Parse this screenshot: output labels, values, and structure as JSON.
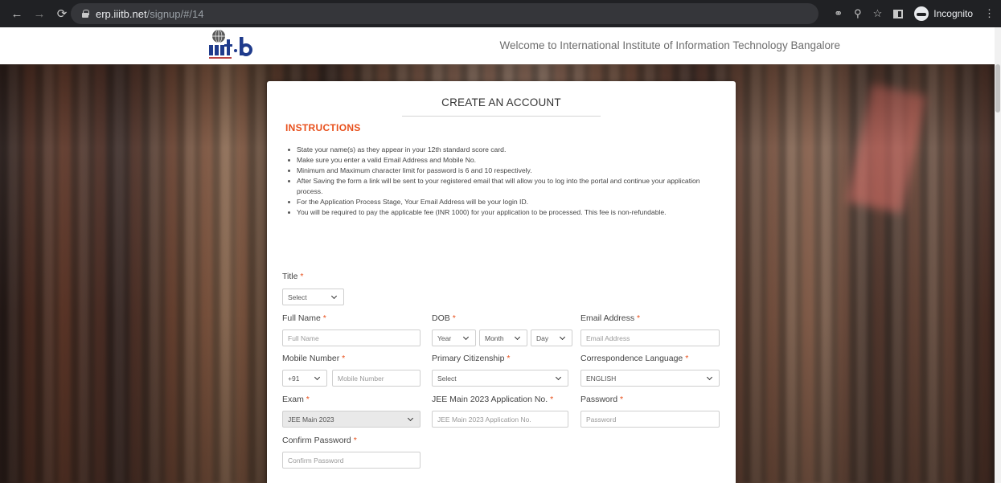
{
  "browser": {
    "url_host": "erp.iiitb.net",
    "url_path": "/signup/#/14",
    "incognito_label": "Incognito",
    "icons": [
      "back-icon",
      "forward-icon",
      "reload-icon",
      "lock-icon",
      "key-icon",
      "zoom-icon",
      "star-icon",
      "side-panel-icon",
      "incognito-icon",
      "menu-icon"
    ]
  },
  "header": {
    "logo_text": "iiit·b",
    "welcome": "Welcome to International Institute of Information Technology Bangalore"
  },
  "form": {
    "title": "CREATE AN ACCOUNT",
    "instructions_heading": "INSTRUCTIONS",
    "instructions": [
      "State your name(s) as they appear in your 12th standard score card.",
      "Make sure you enter a valid Email Address and Mobile No.",
      "Minimum and Maximum character limit for password is 6 and 10 respectively.",
      "After Saving the form a link will be sent to your registered email that will allow you to log into the portal and continue your application process.",
      "For the Application Process Stage, Your Email Address will be your login ID.",
      "You will be required to pay the applicable fee (INR 1000) for your application to be processed. This fee is non-refundable."
    ],
    "required_mark": "*",
    "fields": {
      "title": {
        "label": "Title",
        "value": "Select"
      },
      "full_name": {
        "label": "Full Name",
        "placeholder": "Full Name"
      },
      "dob": {
        "label": "DOB",
        "year": "Year",
        "month": "Month",
        "day": "Day"
      },
      "email": {
        "label": "Email Address",
        "placeholder": "Email Address"
      },
      "mobile": {
        "label": "Mobile Number",
        "code": "+91",
        "placeholder": "Mobile Number"
      },
      "citizenship": {
        "label": "Primary Citizenship",
        "value": "Select"
      },
      "language": {
        "label": "Correspondence Language",
        "value": "ENGLISH"
      },
      "exam": {
        "label": "Exam",
        "value": "JEE Main 2023"
      },
      "jee_app_no": {
        "label": "JEE Main 2023 Application No.",
        "placeholder": "JEE Main 2023 Application No."
      },
      "password": {
        "label": "Password",
        "placeholder": "Password"
      },
      "confirm_password": {
        "label": "Confirm Password",
        "placeholder": "Confirm Password"
      }
    }
  },
  "colors": {
    "accent": "#e8501c",
    "chrome_bg": "#202124"
  }
}
